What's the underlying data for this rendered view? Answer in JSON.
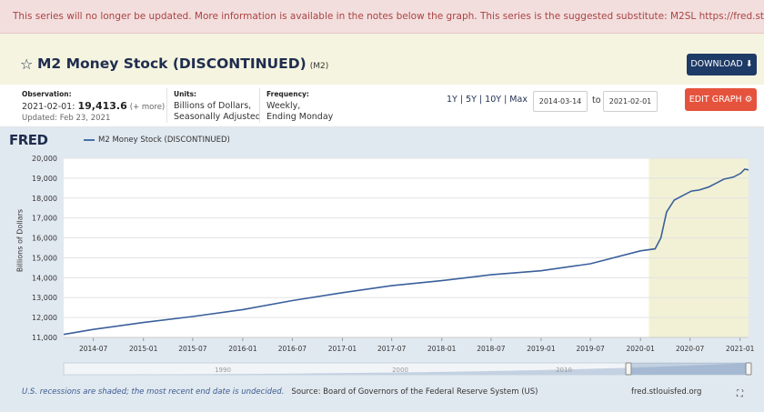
{
  "alert": {
    "text": "This series will no longer be updated. More information is available in the notes below the graph. This series is the suggested substitute: M2SL",
    "link": "https://fred.stlouisfed.org/series/M2SL"
  },
  "header": {
    "title": "M2 Money Stock (DISCONTINUED)",
    "code": "(M2)",
    "download_label": "DOWNLOAD",
    "edit_label": "EDIT GRAPH"
  },
  "meta": {
    "observation_label": "Observation:",
    "observation_date": "2021-02-01:",
    "observation_value": "19,413.6",
    "observation_more": "(+ more)",
    "updated": "Updated: Feb 23, 2021",
    "units_label": "Units:",
    "units_line1": "Billions of Dollars,",
    "units_line2": "Seasonally Adjusted",
    "frequency_label": "Frequency:",
    "frequency_line1": "Weekly,",
    "frequency_line2": "Ending Monday",
    "ranges": "1Y | 5Y | 10Y | Max",
    "start_date": "2014-03-14",
    "to_label": "to",
    "end_date": "2021-02-01"
  },
  "footer": {
    "recession_note": "U.S. recessions are shaded; the most recent end date is undecided.",
    "source": "Source: Board of Governors of the Federal Reserve System (US)",
    "site": "fred.stlouisfed.org"
  },
  "colors": {
    "line": "#3a5f9c",
    "recession": "#f2f1d5",
    "download_button": "#1e3a66",
    "edit_button": "#e5533d",
    "alert_text": "#a84442"
  },
  "chart_data": {
    "type": "line",
    "logo": "FRED",
    "title": "",
    "legend": [
      "M2 Money Stock (DISCONTINUED)"
    ],
    "ylabel": "Billions of Dollars",
    "xlabel": "",
    "ylim": [
      11000,
      20000
    ],
    "yticks": [
      11000,
      12000,
      13000,
      14000,
      15000,
      16000,
      17000,
      18000,
      19000,
      20000
    ],
    "ytick_labels": [
      "11,000",
      "12,000",
      "13,000",
      "14,000",
      "15,000",
      "16,000",
      "17,000",
      "18,000",
      "19,000",
      "20,000"
    ],
    "xlim": [
      "2014-03-14",
      "2021-02-01"
    ],
    "xticks": [
      "2014-07",
      "2015-01",
      "2015-07",
      "2016-01",
      "2016-07",
      "2017-01",
      "2017-07",
      "2018-01",
      "2018-07",
      "2019-01",
      "2019-07",
      "2020-01",
      "2020-07",
      "2021-01"
    ],
    "recession_shading": [
      [
        "2020-02-01",
        "2021-02-01"
      ]
    ],
    "grid": true,
    "navigator_labels": [
      "1990",
      "2000",
      "2010"
    ],
    "series": [
      {
        "name": "M2 Money Stock (DISCONTINUED)",
        "x": [
          "2014-03-14",
          "2014-07-01",
          "2015-01-01",
          "2015-07-01",
          "2016-01-01",
          "2016-07-01",
          "2017-01-01",
          "2017-07-01",
          "2018-01-01",
          "2018-07-01",
          "2019-01-01",
          "2019-07-01",
          "2020-01-01",
          "2020-02-24",
          "2020-03-16",
          "2020-04-06",
          "2020-05-04",
          "2020-06-01",
          "2020-07-06",
          "2020-08-03",
          "2020-09-07",
          "2020-10-05",
          "2020-11-02",
          "2020-12-07",
          "2021-01-04",
          "2021-01-18",
          "2021-02-01"
        ],
        "values": [
          11150,
          11400,
          11750,
          12050,
          12400,
          12850,
          13250,
          13600,
          13850,
          14150,
          14350,
          14700,
          15350,
          15450,
          16000,
          17300,
          17900,
          18100,
          18350,
          18400,
          18550,
          18750,
          18950,
          19050,
          19250,
          19450,
          19413.6
        ]
      }
    ]
  }
}
